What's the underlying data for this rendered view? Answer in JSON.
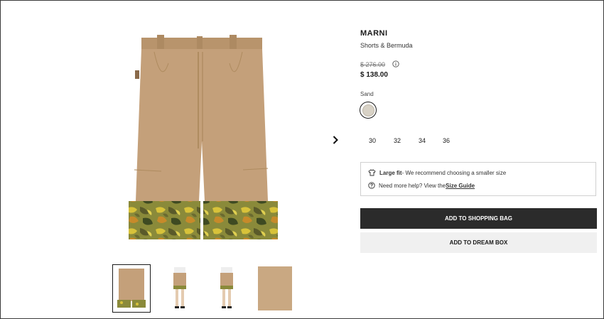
{
  "product": {
    "brand": "MARNI",
    "category": "Shorts & Bermuda",
    "original_price": "$ 276.00",
    "sale_price": "$ 138.00"
  },
  "color": {
    "label": "Sand",
    "swatch_hex": "#d8d2c6"
  },
  "sizes": [
    "30",
    "32",
    "34",
    "36"
  ],
  "fit": {
    "title": "Large fit",
    "note": " - We recommend choosing a smaller size",
    "help_text": "Need more help? View the ",
    "size_guide_link": "Size Guide"
  },
  "actions": {
    "add_to_bag": "ADD TO SHOPPING BAG",
    "add_to_dream_box": "ADD TO DREAM BOX"
  },
  "gallery": {
    "selected_thumbnail": 1,
    "thumbnail_count": 4,
    "icons": [
      "chevron-right-icon",
      "info-icon",
      "hanger-icon",
      "question-icon"
    ]
  },
  "colors": {
    "shorts": "#c4a07a",
    "primary_button": "#2b2b2b",
    "secondary_button": "#f0f0f0"
  }
}
